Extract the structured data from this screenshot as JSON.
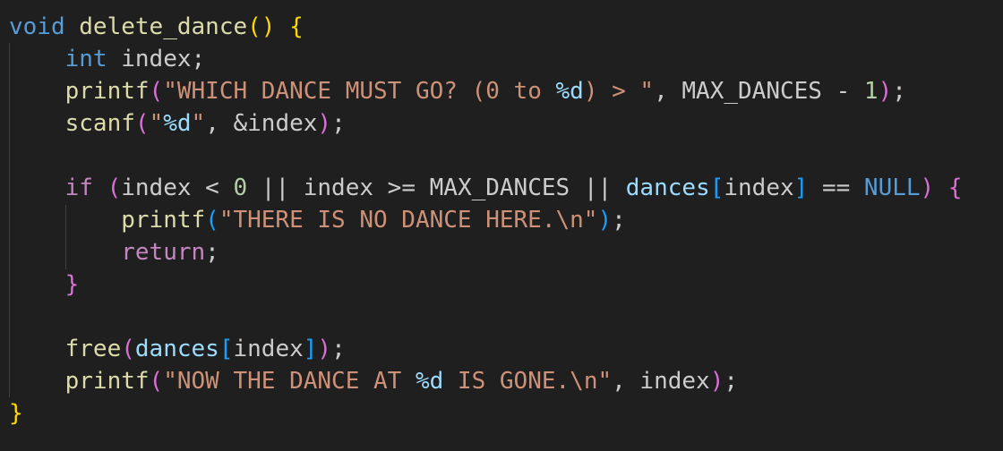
{
  "colors": {
    "background": "#1f1f1f",
    "keyword": "#569cd6",
    "function": "#dcdcaa",
    "plain": "#cccccc",
    "string": "#ce9178",
    "format_specifier": "#9cdcfe",
    "number": "#b5cea8",
    "control_keyword": "#c586c0",
    "bracket_gold": "#ffd700",
    "bracket_pink": "#da70d6",
    "bracket_blue": "#179fff",
    "indent_guide": "#404040"
  },
  "code": {
    "language": "c",
    "lines": [
      [
        {
          "text": "void",
          "type": "keyword"
        },
        {
          "text": " ",
          "type": "plain"
        },
        {
          "text": "delete_dance",
          "type": "function"
        },
        {
          "text": "()",
          "type": "bracket_gold"
        },
        {
          "text": " ",
          "type": "plain"
        },
        {
          "text": "{",
          "type": "bracket_gold"
        }
      ],
      [
        {
          "text": "    ",
          "type": "plain"
        },
        {
          "text": "int",
          "type": "keyword"
        },
        {
          "text": " index;",
          "type": "plain"
        }
      ],
      [
        {
          "text": "    ",
          "type": "plain"
        },
        {
          "text": "printf",
          "type": "function"
        },
        {
          "text": "(",
          "type": "bracket_pink"
        },
        {
          "text": "\"WHICH DANCE MUST GO? (0 to ",
          "type": "string"
        },
        {
          "text": "%d",
          "type": "format_specifier"
        },
        {
          "text": ") > \"",
          "type": "string"
        },
        {
          "text": ", MAX_DANCES - ",
          "type": "plain"
        },
        {
          "text": "1",
          "type": "number"
        },
        {
          "text": ")",
          "type": "bracket_pink"
        },
        {
          "text": ";",
          "type": "plain"
        }
      ],
      [
        {
          "text": "    ",
          "type": "plain"
        },
        {
          "text": "scanf",
          "type": "function"
        },
        {
          "text": "(",
          "type": "bracket_pink"
        },
        {
          "text": "\"",
          "type": "string"
        },
        {
          "text": "%d",
          "type": "format_specifier"
        },
        {
          "text": "\"",
          "type": "string"
        },
        {
          "text": ", &index",
          "type": "plain"
        },
        {
          "text": ")",
          "type": "bracket_pink"
        },
        {
          "text": ";",
          "type": "plain"
        }
      ],
      [],
      [
        {
          "text": "    ",
          "type": "plain"
        },
        {
          "text": "if",
          "type": "control_keyword"
        },
        {
          "text": " ",
          "type": "plain"
        },
        {
          "text": "(",
          "type": "bracket_pink"
        },
        {
          "text": "index < ",
          "type": "plain"
        },
        {
          "text": "0",
          "type": "number"
        },
        {
          "text": " || index >= MAX_DANCES || ",
          "type": "plain"
        },
        {
          "text": "dances",
          "type": "format_specifier"
        },
        {
          "text": "[",
          "type": "bracket_blue"
        },
        {
          "text": "index",
          "type": "plain"
        },
        {
          "text": "]",
          "type": "bracket_blue"
        },
        {
          "text": " == ",
          "type": "plain"
        },
        {
          "text": "NULL",
          "type": "keyword"
        },
        {
          "text": ")",
          "type": "bracket_pink"
        },
        {
          "text": " ",
          "type": "plain"
        },
        {
          "text": "{",
          "type": "bracket_pink"
        }
      ],
      [
        {
          "text": "        ",
          "type": "plain"
        },
        {
          "text": "printf",
          "type": "function"
        },
        {
          "text": "(",
          "type": "bracket_blue"
        },
        {
          "text": "\"THERE IS NO DANCE HERE.\\n\"",
          "type": "string"
        },
        {
          "text": ")",
          "type": "bracket_blue"
        },
        {
          "text": ";",
          "type": "plain"
        }
      ],
      [
        {
          "text": "        ",
          "type": "plain"
        },
        {
          "text": "return",
          "type": "control_keyword"
        },
        {
          "text": ";",
          "type": "plain"
        }
      ],
      [
        {
          "text": "    ",
          "type": "plain"
        },
        {
          "text": "}",
          "type": "bracket_pink"
        }
      ],
      [],
      [
        {
          "text": "    ",
          "type": "plain"
        },
        {
          "text": "free",
          "type": "function"
        },
        {
          "text": "(",
          "type": "bracket_pink"
        },
        {
          "text": "dances",
          "type": "format_specifier"
        },
        {
          "text": "[",
          "type": "bracket_blue"
        },
        {
          "text": "index",
          "type": "plain"
        },
        {
          "text": "]",
          "type": "bracket_blue"
        },
        {
          "text": ")",
          "type": "bracket_pink"
        },
        {
          "text": ";",
          "type": "plain"
        }
      ],
      [
        {
          "text": "    ",
          "type": "plain"
        },
        {
          "text": "printf",
          "type": "function"
        },
        {
          "text": "(",
          "type": "bracket_pink"
        },
        {
          "text": "\"NOW THE DANCE AT ",
          "type": "string"
        },
        {
          "text": "%d",
          "type": "format_specifier"
        },
        {
          "text": " IS GONE.\\n\"",
          "type": "string"
        },
        {
          "text": ", index",
          "type": "plain"
        },
        {
          "text": ")",
          "type": "bracket_pink"
        },
        {
          "text": ";",
          "type": "plain"
        }
      ],
      [
        {
          "text": "}",
          "type": "bracket_gold"
        }
      ]
    ]
  }
}
